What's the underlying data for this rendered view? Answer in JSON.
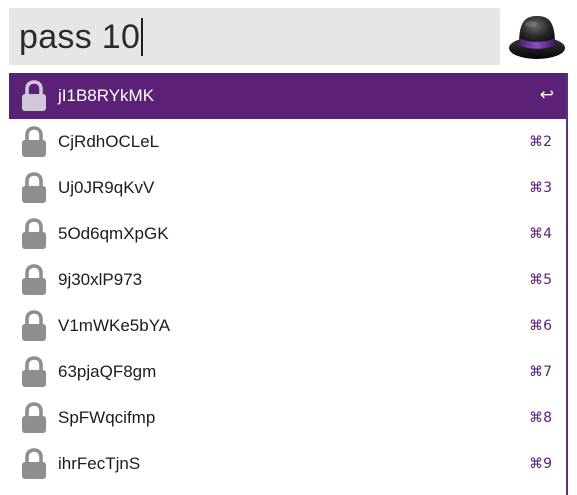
{
  "search": {
    "query": "pass 10"
  },
  "app": {
    "icon": "alfred-hat-icon"
  },
  "icons": {
    "result_icon": "lock-icon",
    "selected_shortcut_icon": "return-key-icon"
  },
  "colors": {
    "accent": "#5b2177",
    "search_background": "#e6e6e6",
    "lock_gray": "#8e8e8e"
  },
  "results": [
    {
      "title": "jI1B8RYkMK",
      "shortcut": "↩",
      "selected": true
    },
    {
      "title": "CjRdhOCLeL",
      "shortcut": "⌘2",
      "selected": false
    },
    {
      "title": "Uj0JR9qKvV",
      "shortcut": "⌘3",
      "selected": false
    },
    {
      "title": "5Od6qmXpGK",
      "shortcut": "⌘4",
      "selected": false
    },
    {
      "title": "9j30xlP973",
      "shortcut": "⌘5",
      "selected": false
    },
    {
      "title": "V1mWKe5bYA",
      "shortcut": "⌘6",
      "selected": false
    },
    {
      "title": "63pjaQF8gm",
      "shortcut": "⌘7",
      "selected": false
    },
    {
      "title": "SpFWqcifmp",
      "shortcut": "⌘8",
      "selected": false
    },
    {
      "title": "ihrFecTjnS",
      "shortcut": "⌘9",
      "selected": false
    }
  ]
}
